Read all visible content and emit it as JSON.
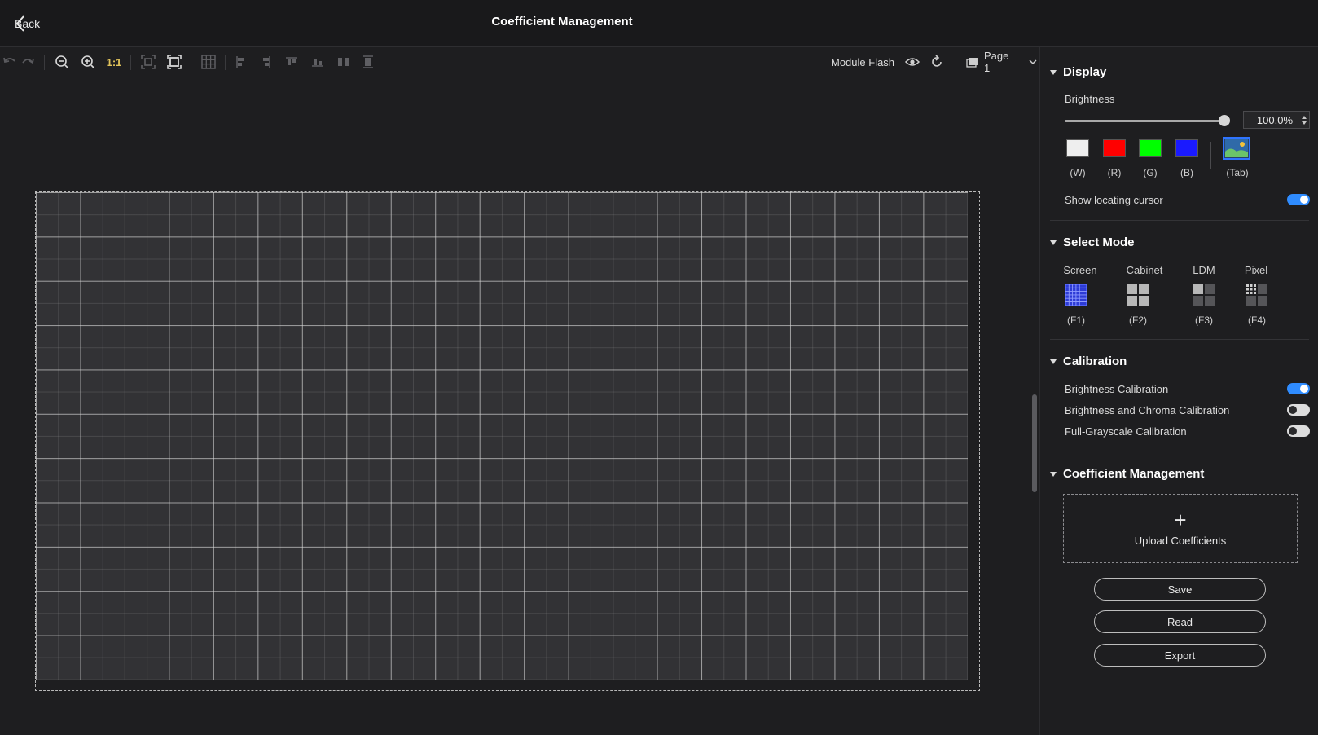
{
  "header": {
    "back_label": "Back",
    "title": "Coefficient Management"
  },
  "toolbar": {
    "ratio_label": "1:1",
    "module_flash_label": "Module Flash",
    "page_label": "Page 1",
    "icons": [
      "undo-icon",
      "redo-icon",
      "zoom-out-icon",
      "zoom-in-icon",
      "fit-icon",
      "fit-screen-icon",
      "grid-icon",
      "align-left-icon",
      "align-right-icon",
      "align-top-icon",
      "align-bottom-icon",
      "distribute-horizontal-icon",
      "distribute-vertical-icon"
    ]
  },
  "canvas": {
    "columns": 21,
    "rows": 11
  },
  "display": {
    "section_title": "Display",
    "brightness_label": "Brightness",
    "brightness_value": "100.0%",
    "brightness_level": 1.0,
    "colors": [
      {
        "label": "(W)",
        "hex": "#eeeeee"
      },
      {
        "label": "(R)",
        "hex": "#ff0000"
      },
      {
        "label": "(G)",
        "hex": "#00ff00"
      },
      {
        "label": "(B)",
        "hex": "#1a1aff"
      }
    ],
    "tab_label": "(Tab)",
    "cursor_label": "Show locating cursor",
    "cursor_on": true
  },
  "select_mode": {
    "section_title": "Select Mode",
    "modes": [
      {
        "name": "Screen",
        "key": "(F1)"
      },
      {
        "name": "Cabinet",
        "key": "(F2)"
      },
      {
        "name": "LDM",
        "key": "(F3)"
      },
      {
        "name": "Pixel",
        "key": "(F4)"
      }
    ]
  },
  "calibration": {
    "section_title": "Calibration",
    "items": [
      {
        "label": "Brightness Calibration",
        "on": true
      },
      {
        "label": "Brightness and Chroma Calibration",
        "on": false
      },
      {
        "label": "Full-Grayscale Calibration",
        "on": false
      }
    ]
  },
  "coefficient": {
    "section_title": "Coefficient Management",
    "upload_label": "Upload Coefficients",
    "save_label": "Save",
    "read_label": "Read",
    "export_label": "Export"
  },
  "colors": {
    "accent": "#2f8cff",
    "background": "#1e1e20",
    "ratio": "#e0c25a"
  }
}
